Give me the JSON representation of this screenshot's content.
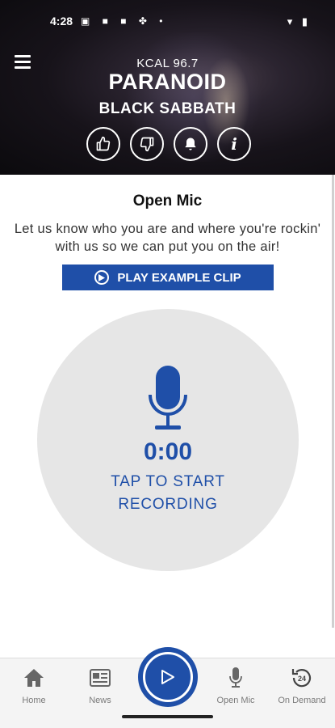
{
  "status_bar": {
    "time": "4:28",
    "left_icons": "▣ ■ ■ ✤ •",
    "right_icons": "▾ ▮"
  },
  "now_playing": {
    "station": "KCAL 96.7",
    "title": "PARANOID",
    "artist": "BLACK SABBATH",
    "info_label": "i"
  },
  "open_mic": {
    "title": "Open Mic",
    "description": "Let us know who you are and where you're rockin' with us so we can put you on the air!",
    "play_example_label": "PLAY EXAMPLE CLIP",
    "timer": "0:00",
    "tap_line1": "TAP TO START",
    "tap_line2": "RECORDING"
  },
  "bottom_nav": {
    "items": [
      {
        "label": "Home",
        "icon": "home-icon"
      },
      {
        "label": "News",
        "icon": "news-icon"
      },
      {
        "label": "Open Mic",
        "icon": "microphone-icon"
      },
      {
        "label": "On Demand",
        "icon": "on-demand-24-icon"
      }
    ],
    "on_demand_badge": "24"
  },
  "colors": {
    "accent": "#1f4fa8",
    "record_circle": "#e6e6e6",
    "nav_background": "#f4f4f4"
  }
}
